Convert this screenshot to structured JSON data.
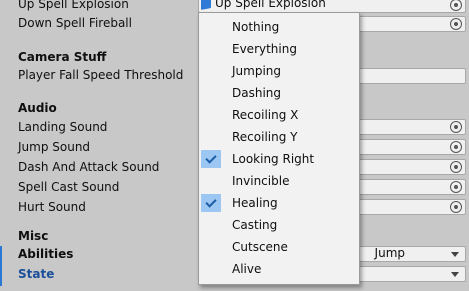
{
  "inspector": {
    "up_spell": {
      "label": "Up Spell Explosion",
      "value": "Up Spell Explosion"
    },
    "down_spell": {
      "label": "Down Spell Fireball"
    },
    "camera_header": "Camera Stuff",
    "fall_speed": {
      "label": "Player Fall Speed Threshold"
    },
    "audio_header": "Audio",
    "sounds": [
      {
        "label": "Landing Sound"
      },
      {
        "label": "Jump Sound"
      },
      {
        "label": "Dash And Attack Sound"
      },
      {
        "label": "Spell Cast Sound"
      },
      {
        "label": "Hurt Sound"
      }
    ],
    "misc_header": "Misc",
    "abilities": {
      "label": "Abilities",
      "value": "Jump"
    },
    "state": {
      "label": "State"
    }
  },
  "menu": {
    "items": [
      {
        "label": "Nothing",
        "checked": false
      },
      {
        "label": "Everything",
        "checked": false
      },
      {
        "label": "Jumping",
        "checked": false
      },
      {
        "label": "Dashing",
        "checked": false
      },
      {
        "label": "Recoiling X",
        "checked": false
      },
      {
        "label": "Recoiling Y",
        "checked": false
      },
      {
        "label": "Looking Right",
        "checked": true
      },
      {
        "label": "Invincible",
        "checked": false
      },
      {
        "label": "Healing",
        "checked": true
      },
      {
        "label": "Casting",
        "checked": false
      },
      {
        "label": "Cutscene",
        "checked": false
      },
      {
        "label": "Alive",
        "checked": false
      }
    ]
  },
  "colors": {
    "check_bg": "#9cc7f2",
    "accent": "#2a78d4",
    "panel_bg": "#c8c8c8"
  },
  "icons": {
    "object_icon": "cube-icon",
    "picker_icon": "object-picker-icon",
    "dropdown_icon": "chevron-down-icon"
  }
}
